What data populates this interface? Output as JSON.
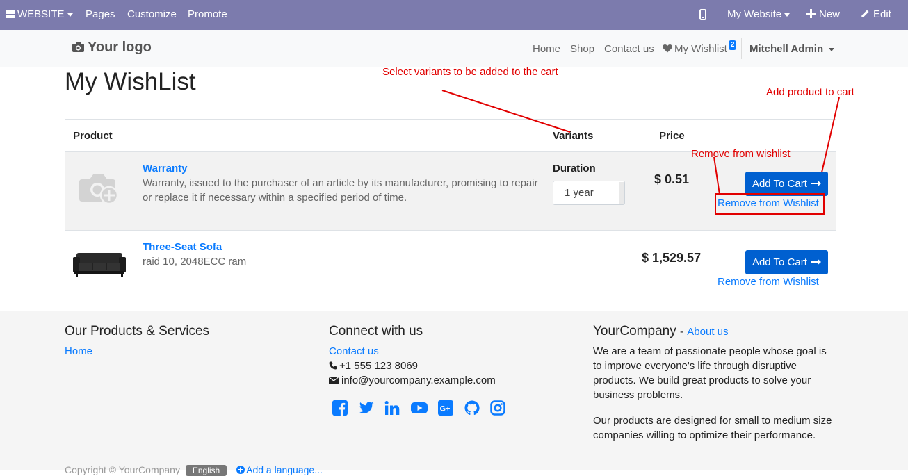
{
  "admin_bar": {
    "website_menu": "WEBSITE",
    "pages": "Pages",
    "customize": "Customize",
    "promote": "Promote",
    "my_website": "My Website",
    "new": "New",
    "edit": "Edit"
  },
  "header": {
    "logo": "Your logo",
    "nav": [
      "Home",
      "Shop",
      "Contact us"
    ],
    "wishlist_label": "My Wishlist",
    "wishlist_count": "2",
    "user": "Mitchell Admin"
  },
  "page_title": "My WishList",
  "table": {
    "columns": [
      "Product",
      "Variants",
      "Price"
    ],
    "rows": [
      {
        "name": "Warranty",
        "description": "Warranty, issued to the purchaser of an article by its manufacturer, promising to repair or replace it if necessary within a specified period of time.",
        "variant_label": "Duration",
        "variant_value": "1 year",
        "price": "$ 0.51",
        "add_label": "Add To Cart",
        "remove_label": "Remove from Wishlist"
      },
      {
        "name": "Three-Seat Sofa",
        "description": "raid 10, 2048ECC ram",
        "price": "$ 1,529.57",
        "add_label": "Add To Cart",
        "remove_label": "Remove from Wishlist"
      }
    ]
  },
  "annotations": {
    "variants": "Select variants to be added to the cart",
    "add": "Add product to cart",
    "remove": "Remove from wishlist"
  },
  "footer": {
    "products_title": "Our Products & Services",
    "products_link": "Home",
    "connect_title": "Connect with us",
    "contact_link": "Contact us",
    "phone": "+1 555 123 8069",
    "email": "info@yourcompany.example.com",
    "company_title": "YourCompany",
    "company_sep": "-",
    "about_link": "About us",
    "about_text_1": "We are a team of passionate people whose goal is to improve everyone's life through disruptive products. We build great products to solve your business problems.",
    "about_text_2": "Our products are designed for small to medium size companies willing to optimize their performance.",
    "copyright": "Copyright © YourCompany",
    "language": "English",
    "add_language": "Add a language..."
  },
  "social_icons": [
    "facebook-icon",
    "twitter-icon",
    "linkedin-icon",
    "youtube-icon",
    "google-plus-icon",
    "github-icon",
    "instagram-icon"
  ],
  "colors": {
    "admin_bar": "#7c7bad",
    "link": "#0a7bff",
    "button": "#0060d0",
    "annotation": "#e10000"
  }
}
